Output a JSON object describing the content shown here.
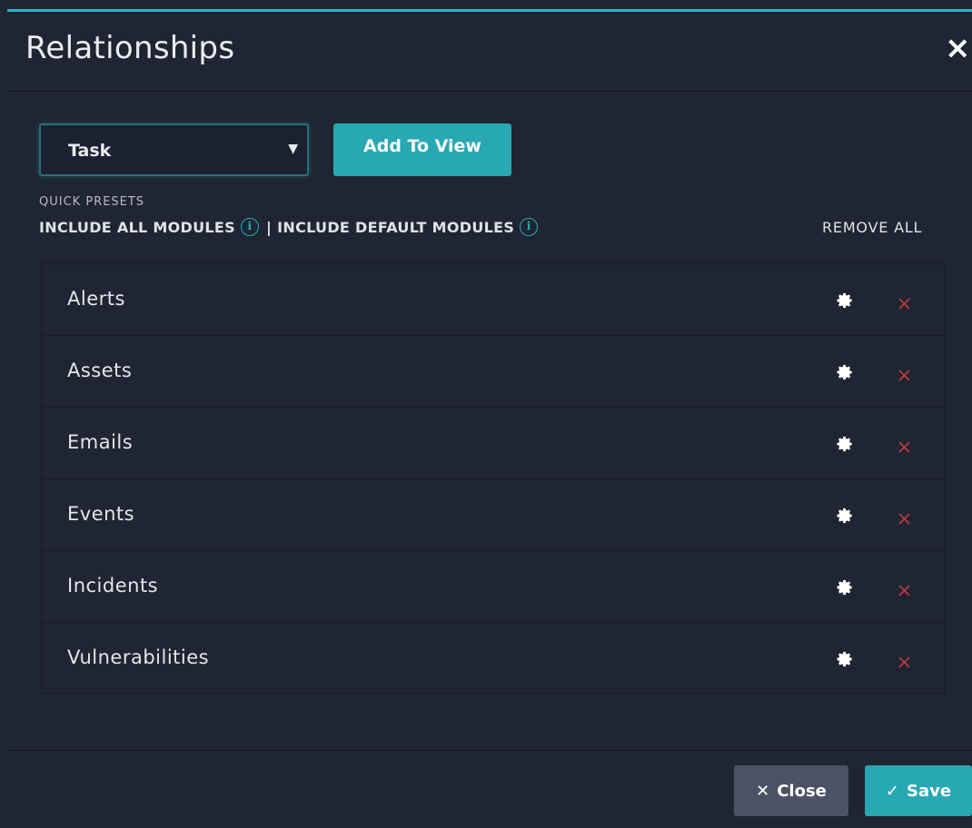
{
  "modal": {
    "title": "Relationships",
    "close_icon": "close-icon"
  },
  "controls": {
    "select_value": "Task",
    "select_caret": "▼",
    "add_button_label": "Add To View"
  },
  "presets": {
    "section_label": "QUICK PRESETS",
    "include_all_label": "INCLUDE ALL MODULES",
    "separator": "|",
    "include_default_label": "INCLUDE DEFAULT MODULES",
    "info_glyph": "i",
    "remove_all_label": "REMOVE ALL"
  },
  "modules": [
    {
      "label": "Alerts"
    },
    {
      "label": "Assets"
    },
    {
      "label": "Emails"
    },
    {
      "label": "Events"
    },
    {
      "label": "Incidents"
    },
    {
      "label": "Vulnerabilities"
    }
  ],
  "footer": {
    "close_label": "Close",
    "save_label": "Save"
  },
  "colors": {
    "background": "#1f2532",
    "accent": "#27a8b3",
    "remove_red": "#c0393f",
    "close_button": "#4a5263"
  }
}
